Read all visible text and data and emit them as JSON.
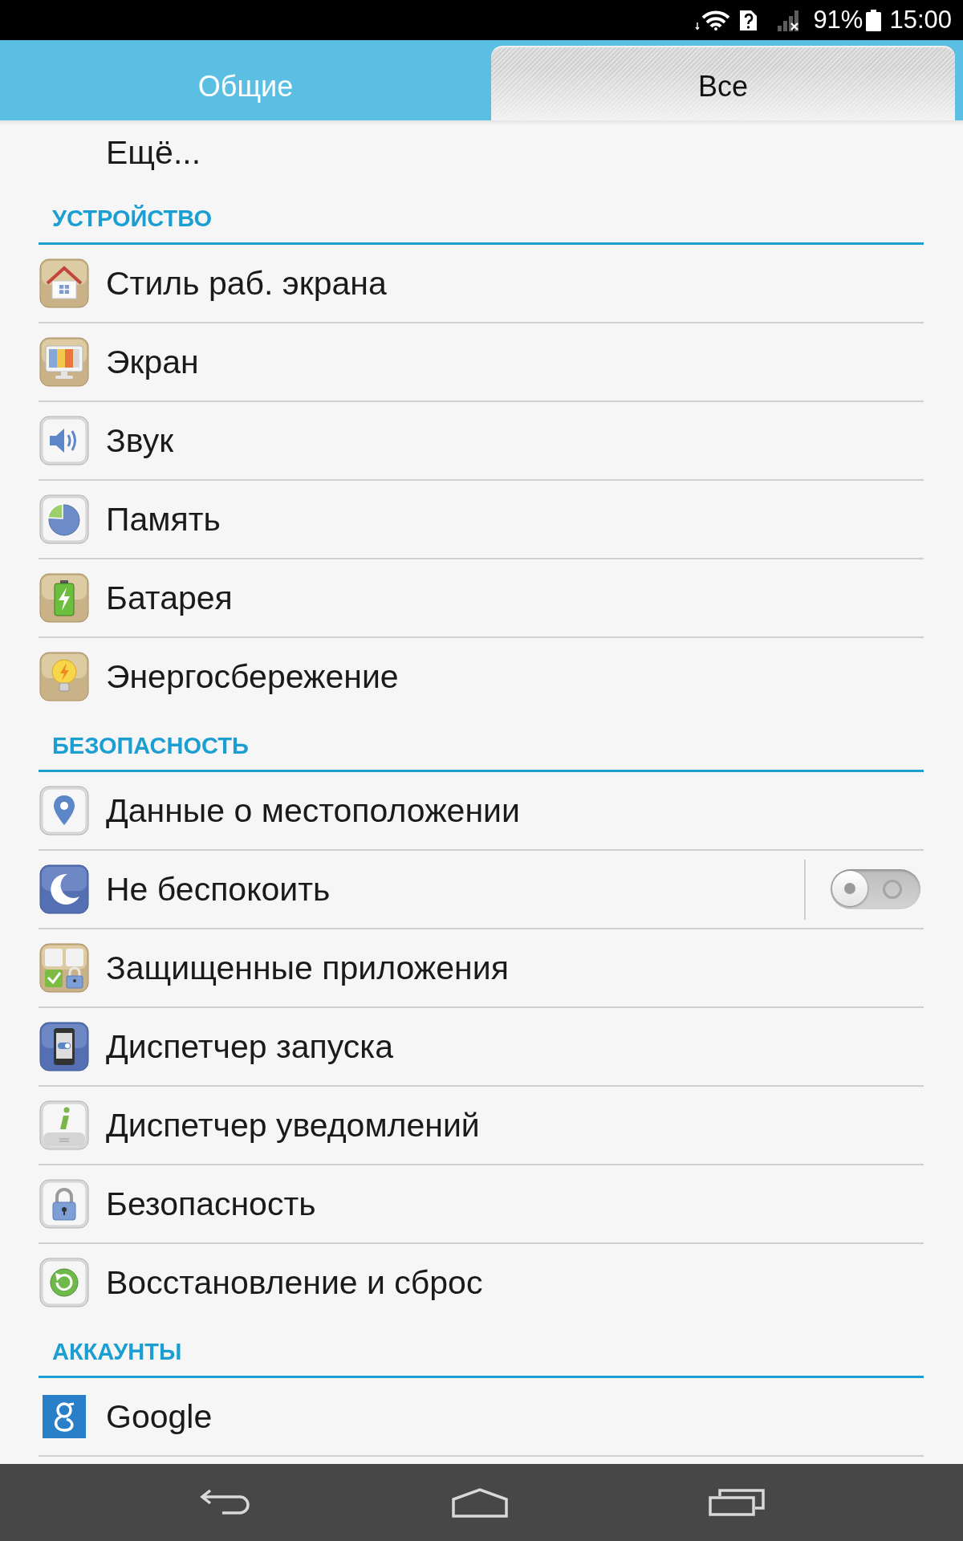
{
  "status_bar": {
    "battery_text": "91%",
    "time": "15:00"
  },
  "tabs": [
    {
      "label": "Общие",
      "selected": false
    },
    {
      "label": "Все",
      "selected": true
    }
  ],
  "top_item": {
    "label": "Ещё..."
  },
  "sections": [
    {
      "title": "УСТРОЙСТВО",
      "items": [
        {
          "label": "Стиль раб. экрана",
          "kind": "link"
        },
        {
          "label": "Экран",
          "kind": "link"
        },
        {
          "label": "Звук",
          "kind": "link"
        },
        {
          "label": "Память",
          "kind": "link"
        },
        {
          "label": "Батарея",
          "kind": "link"
        },
        {
          "label": "Энергосбережение",
          "kind": "link"
        }
      ]
    },
    {
      "title": "БЕЗОПАСНОСТЬ",
      "items": [
        {
          "label": "Данные о местоположении",
          "kind": "link"
        },
        {
          "label": "Не беспокоить",
          "kind": "switch",
          "on": false
        },
        {
          "label": "Защищенные приложения",
          "kind": "link"
        },
        {
          "label": "Диспетчер запуска",
          "kind": "link"
        },
        {
          "label": "Диспетчер уведомлений",
          "kind": "link"
        },
        {
          "label": "Безопасность",
          "kind": "link"
        },
        {
          "label": "Восстановление и сброс",
          "kind": "link"
        }
      ]
    },
    {
      "title": "АККАУНТЫ",
      "items": [
        {
          "label": "Google",
          "kind": "link"
        }
      ]
    }
  ]
}
